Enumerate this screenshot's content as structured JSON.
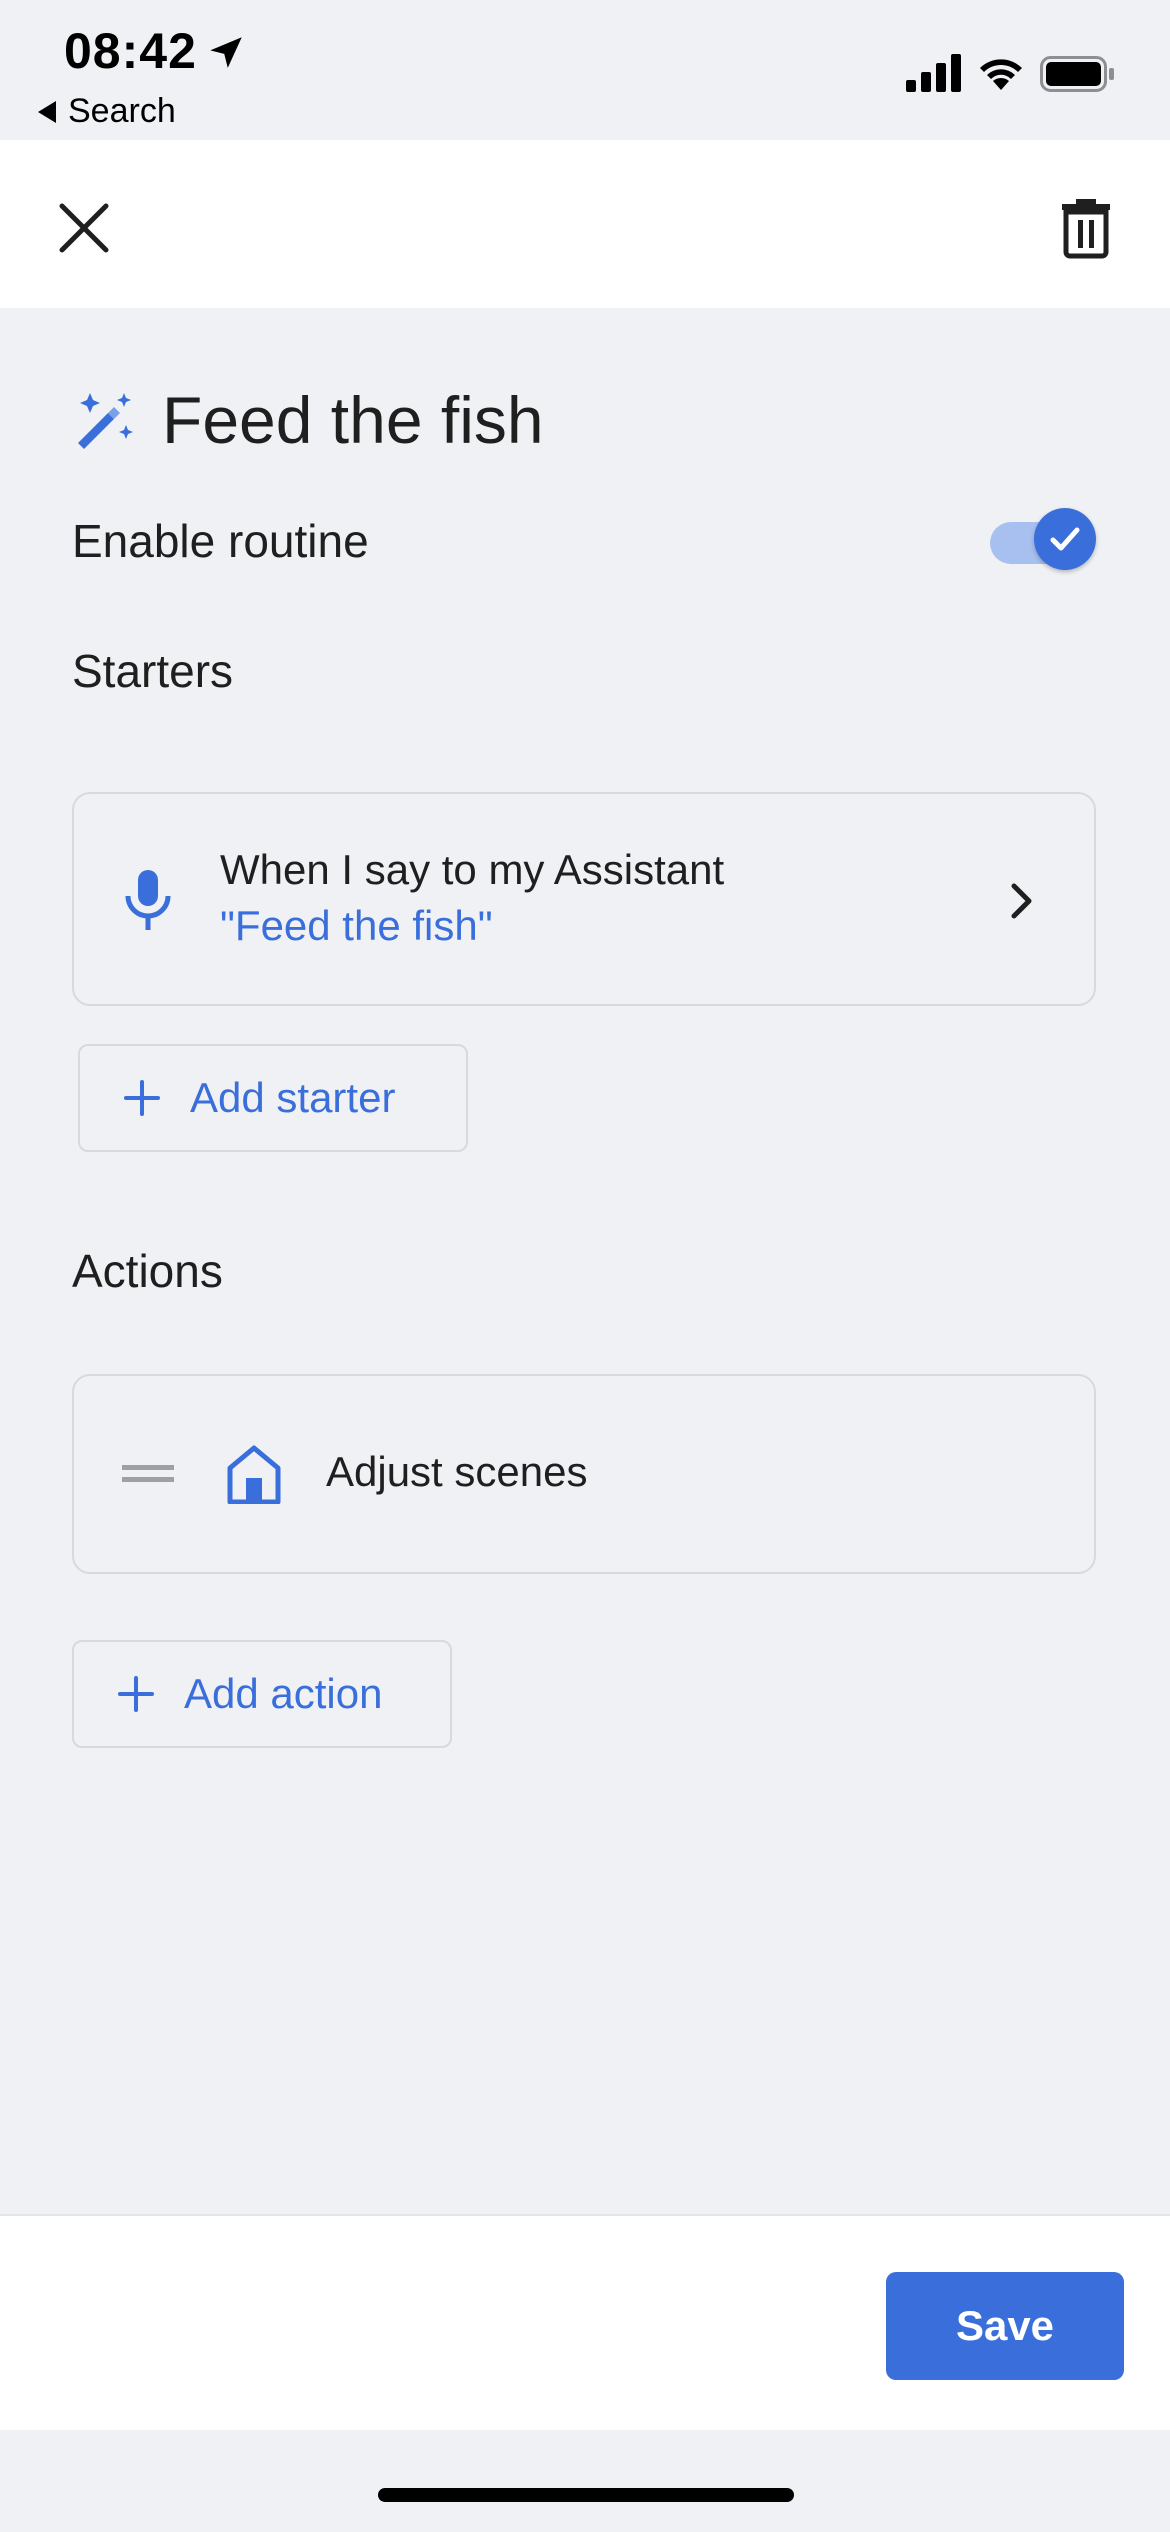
{
  "status_bar": {
    "time": "08:42",
    "back_label": "Search"
  },
  "routine": {
    "title": "Feed the fish",
    "enable_label": "Enable routine",
    "enabled": true
  },
  "starters": {
    "heading": "Starters",
    "items": [
      {
        "line1": "When I say to my Assistant",
        "line2": "\"Feed the fish\""
      }
    ],
    "add_label": "Add starter"
  },
  "actions": {
    "heading": "Actions",
    "items": [
      {
        "label": "Adjust scenes"
      }
    ],
    "add_label": "Add action"
  },
  "footer": {
    "save_label": "Save"
  },
  "colors": {
    "accent": "#3a6fdb",
    "background": "#f0f1f4",
    "toggle_track": "#a8c0f0"
  },
  "icons": [
    "location-arrow-icon",
    "back-triangle-icon",
    "signal-icon",
    "wifi-icon",
    "battery-icon",
    "close-icon",
    "trash-icon",
    "magic-wand-icon",
    "check-icon",
    "mic-icon",
    "chevron-right-icon",
    "plus-icon",
    "drag-handle-icon",
    "home-icon"
  ]
}
